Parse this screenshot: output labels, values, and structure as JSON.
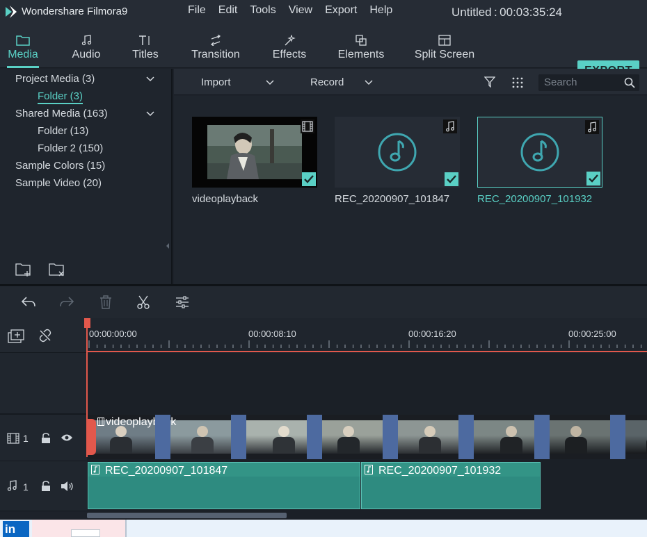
{
  "app": {
    "title": "Wondershare Filmora9",
    "project_title": "Untitled : 00:03:35:24",
    "menu": [
      "File",
      "Edit",
      "Tools",
      "View",
      "Export",
      "Help"
    ]
  },
  "tabs": [
    {
      "label": "Media",
      "icon": "folder-icon"
    },
    {
      "label": "Audio",
      "icon": "music-note-icon"
    },
    {
      "label": "Titles",
      "icon": "text-icon"
    },
    {
      "label": "Transition",
      "icon": "transition-icon"
    },
    {
      "label": "Effects",
      "icon": "effects-icon"
    },
    {
      "label": "Elements",
      "icon": "elements-icon"
    },
    {
      "label": "Split Screen",
      "icon": "split-screen-icon"
    }
  ],
  "export_label": "EXPORT",
  "sidebar": {
    "items": [
      {
        "label": "Project Media (3)"
      },
      {
        "label": "Folder (3)"
      },
      {
        "label": "Shared Media (163)"
      },
      {
        "label": "Folder (13)"
      },
      {
        "label": "Folder 2 (150)"
      },
      {
        "label": "Sample Colors (15)"
      },
      {
        "label": "Sample Video (20)"
      }
    ]
  },
  "media_bar": {
    "import_label": "Import",
    "record_label": "Record",
    "search_placeholder": "Search"
  },
  "media_items": [
    {
      "name": "videoplayback",
      "type": "video"
    },
    {
      "name": "REC_20200907_101847",
      "type": "audio"
    },
    {
      "name": "REC_20200907_101932",
      "type": "audio"
    }
  ],
  "timeline": {
    "timecodes": [
      "00:00:00:00",
      "00:00:08:10",
      "00:00:16:20",
      "00:00:25:00"
    ],
    "video_track_label": "1",
    "audio_track_label": "1",
    "video_clip_name": "videoplayback",
    "audio_clips": [
      "REC_20200907_101847",
      "REC_20200907_101932"
    ]
  },
  "taskbar": {
    "linkedin_label": "in"
  },
  "colors": {
    "accent": "#5ad0c5",
    "playhead": "#e2584c",
    "audio_clip": "#2e8b80",
    "background": "#1d222a"
  }
}
